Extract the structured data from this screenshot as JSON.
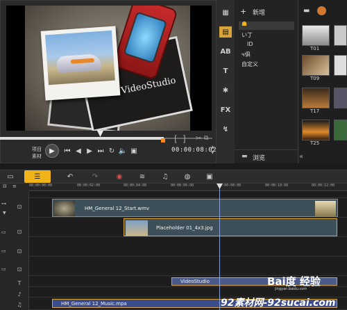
{
  "preview": {
    "overlay_title": "VideoStudio",
    "project_label": "项目",
    "clip_label": "素材",
    "timecode": "00:00:08:02",
    "bracket_in": "[",
    "bracket_out": "]"
  },
  "library": {
    "add_label": "新增",
    "folders": [
      "い丁",
      "ID",
      "ч俱",
      "自定义"
    ],
    "browse_label": "浏览",
    "thumbs": [
      "T01",
      "T09",
      "T17",
      "T25"
    ]
  },
  "timeline": {
    "ruler_ticks": [
      "00:00:00:00",
      "00:00:02:00",
      "00:00:04:00",
      "00:00:06:00",
      "00:00:08:00",
      "00:00:10:00",
      "00:00:12:00"
    ],
    "clips": {
      "video": "HM_General 12_Start.wmv",
      "overlay": "Placeholder 01_4x3.jpg",
      "title": "VideoStudio",
      "music": "HM_General 12_Music.mpa"
    }
  },
  "watermark": {
    "site": "92素材网-92sucai.com",
    "brand": "Bai度 经验",
    "url": "jingyan.baidu.com"
  },
  "colors": {
    "accent": "#f0b418",
    "clip_fill": "#3d4f58",
    "title_clip": "#4a5a8a",
    "music_clip": "#3b4d8c",
    "playhead": "#8aa0d8"
  }
}
